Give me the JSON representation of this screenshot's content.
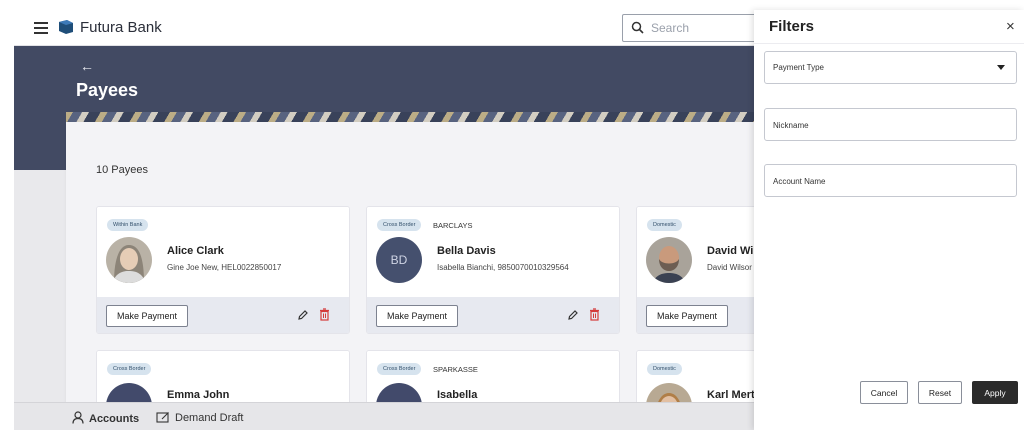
{
  "header": {
    "brand": "Futura Bank",
    "search_placeholder": "Search"
  },
  "page": {
    "back_icon": "←",
    "title": "Payees",
    "count_label": "10 Payees"
  },
  "payees": [
    {
      "badge": "Within Bank",
      "bank": "",
      "name": "Alice Clark",
      "detail": "Gine Joe New, HEL0022850017",
      "avatar": "photo",
      "action": "Make Payment"
    },
    {
      "badge": "Cross Border",
      "bank": "BARCLAYS",
      "name": "Bella Davis",
      "detail": "Isabella Bianchi, 9850070010329564",
      "initials": "BD",
      "action": "Make Payment"
    },
    {
      "badge": "Domestic",
      "bank": "",
      "name": "David Wils",
      "detail": "David Wilsor",
      "avatar": "photo",
      "action": "Make Payment"
    },
    {
      "badge": "Cross Border",
      "bank": "",
      "name": "Emma John"
    },
    {
      "badge": "Cross Border",
      "bank": "SPARKASSE",
      "name": "Isabella"
    },
    {
      "badge": "Domestic",
      "bank": "",
      "name": "Karl Merte"
    }
  ],
  "bottom_nav": {
    "accounts": "Accounts",
    "demand_draft": "Demand Draft"
  },
  "filters": {
    "title": "Filters",
    "close": "×",
    "payment_type_label": "Payment Type",
    "nickname_placeholder": "Nickname",
    "account_name_placeholder": "Account Name",
    "cancel": "Cancel",
    "reset": "Reset",
    "apply": "Apply"
  },
  "colors": {
    "hero": "#424a63",
    "apply_button": "#2b2b2b",
    "delete_icon": "#d43a3a",
    "badge_bg": "#d6e3ee"
  }
}
